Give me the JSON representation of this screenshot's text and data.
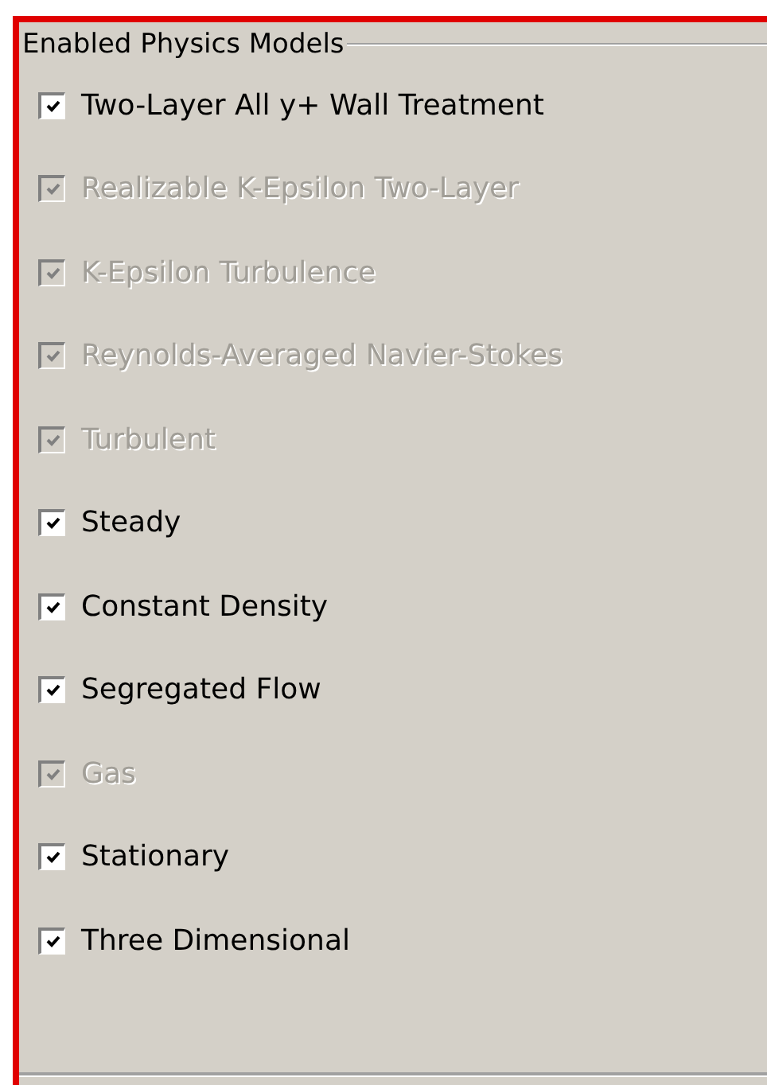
{
  "group": {
    "title": "Enabled Physics Models"
  },
  "models": [
    {
      "label": "Two-Layer All y+ Wall Treatment",
      "checked": true,
      "disabled": false
    },
    {
      "label": "Realizable K-Epsilon Two-Layer",
      "checked": true,
      "disabled": true
    },
    {
      "label": "K-Epsilon Turbulence",
      "checked": true,
      "disabled": true
    },
    {
      "label": "Reynolds-Averaged Navier-Stokes",
      "checked": true,
      "disabled": true
    },
    {
      "label": "Turbulent",
      "checked": true,
      "disabled": true
    },
    {
      "label": "Steady",
      "checked": true,
      "disabled": false
    },
    {
      "label": "Constant Density",
      "checked": true,
      "disabled": false
    },
    {
      "label": "Segregated Flow",
      "checked": true,
      "disabled": false
    },
    {
      "label": "Gas",
      "checked": true,
      "disabled": true
    },
    {
      "label": "Stationary",
      "checked": true,
      "disabled": false
    },
    {
      "label": "Three Dimensional",
      "checked": true,
      "disabled": false
    }
  ]
}
